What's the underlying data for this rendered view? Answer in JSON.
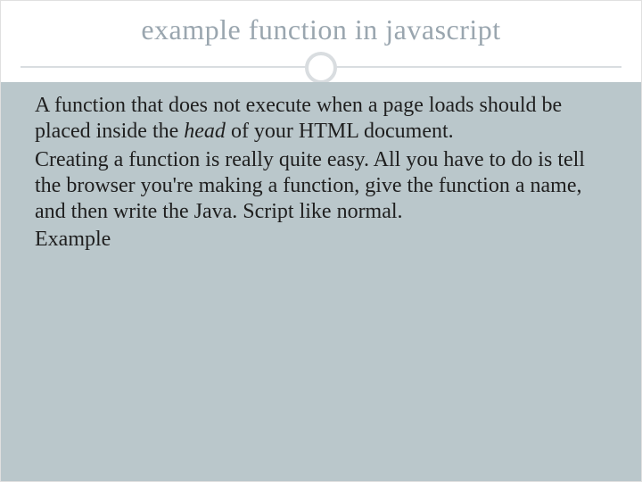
{
  "header": {
    "title": "example function in javascript"
  },
  "body": {
    "p1_a": "A function that does not execute when a page loads should be placed inside the ",
    "p1_em": "head",
    "p1_b": " of your HTML document.",
    "p2": "Creating a function is really quite easy. All you have to do is tell the browser you're making a function, give the function a name, and then write the Java. Script like normal.",
    "p3": "Example"
  }
}
